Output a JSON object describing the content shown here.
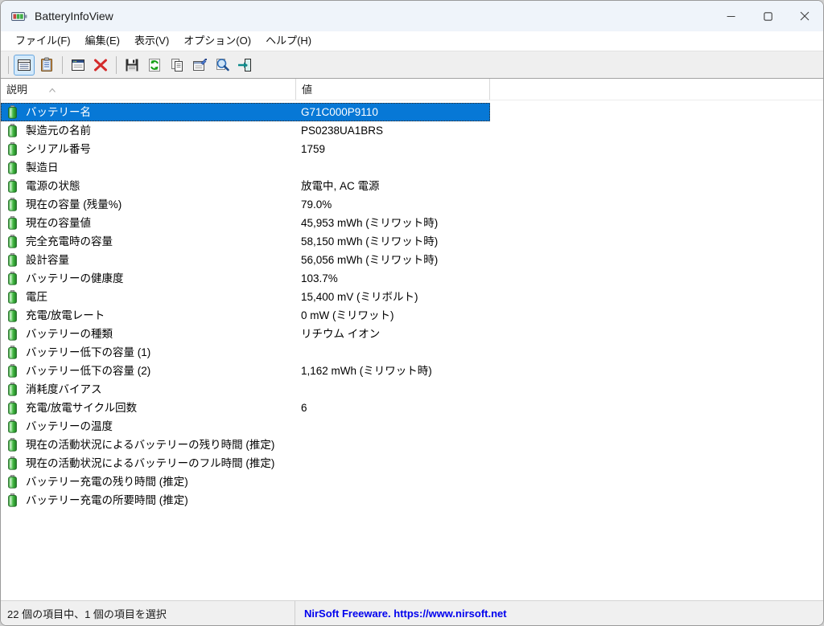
{
  "window": {
    "title": "BatteryInfoView"
  },
  "menu": {
    "items": [
      {
        "label": "ファイル(F)"
      },
      {
        "label": "編集(E)"
      },
      {
        "label": "表示(V)"
      },
      {
        "label": "オプション(O)"
      },
      {
        "label": "ヘルプ(H)"
      }
    ]
  },
  "toolbar": {
    "buttons": [
      {
        "icon": "report-view-icon",
        "selected": true
      },
      {
        "icon": "clipboard-icon",
        "selected": false
      },
      {
        "icon": "window-icon",
        "selected": false
      },
      {
        "icon": "delete-icon",
        "selected": false
      },
      {
        "icon": "save-icon",
        "selected": false
      },
      {
        "icon": "refresh-icon",
        "selected": false
      },
      {
        "icon": "copy-icon",
        "selected": false
      },
      {
        "icon": "properties-icon",
        "selected": false
      },
      {
        "icon": "search-icon",
        "selected": false
      },
      {
        "icon": "exit-icon",
        "selected": false
      }
    ]
  },
  "table": {
    "columns": [
      {
        "label": "説明"
      },
      {
        "label": "値"
      }
    ],
    "selected_index": 0,
    "rows": [
      {
        "desc": "バッテリー名",
        "value": "G71C000P9110"
      },
      {
        "desc": "製造元の名前",
        "value": "PS0238UA1BRS"
      },
      {
        "desc": "シリアル番号",
        "value": "1759"
      },
      {
        "desc": "製造日",
        "value": ""
      },
      {
        "desc": "電源の状態",
        "value": "放電中, AC 電源"
      },
      {
        "desc": "現在の容量 (残量%)",
        "value": "79.0%"
      },
      {
        "desc": "現在の容量値",
        "value": "45,953 mWh (ミリワット時)"
      },
      {
        "desc": "完全充電時の容量",
        "value": "58,150 mWh (ミリワット時)"
      },
      {
        "desc": "設計容量",
        "value": "56,056 mWh (ミリワット時)"
      },
      {
        "desc": "バッテリーの健康度",
        "value": "103.7%"
      },
      {
        "desc": "電圧",
        "value": "15,400 mV (ミリボルト)"
      },
      {
        "desc": "充電/放電レート",
        "value": "0 mW (ミリワット)"
      },
      {
        "desc": "バッテリーの種類",
        "value": "リチウム イオン"
      },
      {
        "desc": "バッテリー低下の容量 (1)",
        "value": ""
      },
      {
        "desc": "バッテリー低下の容量 (2)",
        "value": "1,162 mWh (ミリワット時)"
      },
      {
        "desc": "消耗度バイアス",
        "value": ""
      },
      {
        "desc": "充電/放電サイクル回数",
        "value": "6"
      },
      {
        "desc": "バッテリーの温度",
        "value": ""
      },
      {
        "desc": "現在の活動状況によるバッテリーの残り時間 (推定)",
        "value": ""
      },
      {
        "desc": "現在の活動状況によるバッテリーのフル時間 (推定)",
        "value": ""
      },
      {
        "desc": "バッテリー充電の残り時間 (推定)",
        "value": ""
      },
      {
        "desc": "バッテリー充電の所要時間 (推定)",
        "value": ""
      }
    ]
  },
  "statusbar": {
    "left": "22 個の項目中、1 個の項目を選択",
    "right": "NirSoft Freeware. https://www.nirsoft.net"
  },
  "colors": {
    "selection": "#0778d6",
    "link_blue": "#0000ee",
    "battery_green": "#2fae3a",
    "toolbar_bg": "#efefef",
    "titlebar_bg": "#eff4fa"
  }
}
